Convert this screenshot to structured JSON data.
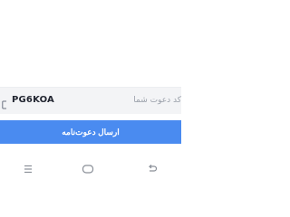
{
  "invite": {
    "label": "کد دعوت شما",
    "code": "PG6KOA",
    "copy_icon": "copy-icon"
  },
  "actions": {
    "send_label": "ارسال دعوت‌نامه",
    "send_color": "#4a8bf0"
  },
  "navbar": {
    "recents_icon": "recents-icon",
    "home_icon": "home-icon",
    "back_icon": "back-icon"
  }
}
